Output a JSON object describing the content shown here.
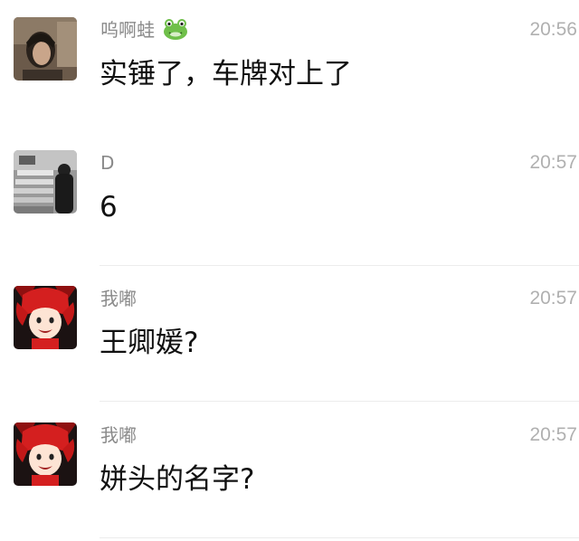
{
  "messages": [
    {
      "sender": "呜啊蛙",
      "sender_emoji": "frog-emoji",
      "time": "20:56",
      "text": "实锤了，车牌对上了",
      "avatar": "woman-portrait-avatar"
    },
    {
      "sender": "D",
      "time": "20:57",
      "text": "6",
      "avatar": "street-scene-avatar"
    },
    {
      "sender": "我嘟",
      "time": "20:57",
      "text": "王卿媛?",
      "avatar": "cartoon-red-hair-girl-avatar"
    },
    {
      "sender": "我嘟",
      "time": "20:57",
      "text": "姘头的名字?",
      "avatar": "cartoon-red-hair-girl-avatar"
    }
  ],
  "colors": {
    "background": "#ffffff",
    "sender": "#8a8a8a",
    "time": "#b0b0b0",
    "text": "#111111",
    "divider": "#ececec"
  }
}
